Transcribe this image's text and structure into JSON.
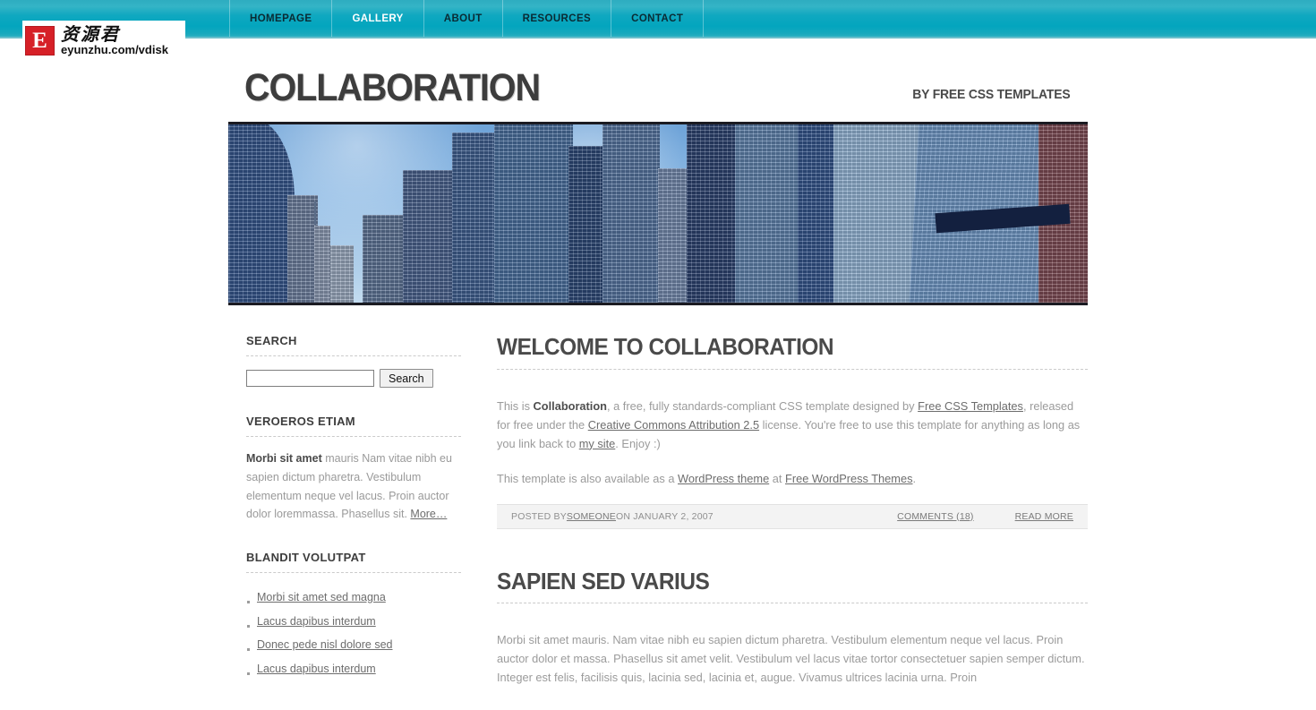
{
  "watermark": {
    "mark_letter": "E",
    "cn_text": "资源君",
    "url_text": "eyunzhu.com/vdisk"
  },
  "nav": {
    "items": [
      {
        "label": "HOMEPAGE",
        "active": false
      },
      {
        "label": "GALLERY",
        "active": true
      },
      {
        "label": "ABOUT",
        "active": false
      },
      {
        "label": "RESOURCES",
        "active": false
      },
      {
        "label": "CONTACT",
        "active": false
      }
    ]
  },
  "masthead": {
    "title": "COLLABORATION",
    "tagline": "BY FREE CSS TEMPLATES"
  },
  "banner": {
    "alt": "skyscrapers-photo"
  },
  "sidebar": {
    "search": {
      "heading": "SEARCH",
      "value": "",
      "placeholder": "",
      "button_label": "Search"
    },
    "about": {
      "heading": "VEROEROS ETIAM",
      "lead": "Morbi sit amet",
      "text": " mauris Nam vitae nibh eu sapien dictum pharetra. Vestibulum elementum neque vel lacus. Proin auctor dolor loremmassa. Phasellus sit. ",
      "more_label": "More…"
    },
    "links": {
      "heading": "BLANDIT VOLUTPAT",
      "items": [
        "Morbi sit amet sed magna",
        "Lacus dapibus interdum",
        "Donec pede nisl dolore sed",
        "Lacus dapibus interdum"
      ]
    }
  },
  "posts": [
    {
      "title": "WELCOME TO COLLABORATION",
      "p1_a": "This is ",
      "p1_b": "Collaboration",
      "p1_c": ", a free, fully standards-compliant CSS template designed by ",
      "p1_link1": "Free CSS Templates",
      "p1_d": ", released for free under the ",
      "p1_link2": "Creative Commons Attribution 2.5",
      "p1_e": " license. You're free to use this template for anything as long as you link back to ",
      "p1_link3": "my site",
      "p1_f": ". Enjoy :)",
      "p2_a": "This template is also available as a ",
      "p2_link1": "WordPress theme",
      "p2_b": " at ",
      "p2_link2": "Free WordPress Themes",
      "p2_c": ".",
      "meta": {
        "posted_by_label": "POSTED BY ",
        "author": "SOMEONE",
        "date_label": " ON JANUARY 2, 2007",
        "comments": "COMMENTS (18)",
        "read_more": "READ MORE"
      }
    },
    {
      "title": "SAPIEN SED VARIUS",
      "body": "Morbi sit amet mauris. Nam vitae nibh eu sapien dictum pharetra. Vestibulum elementum neque vel lacus. Proin auctor dolor et massa. Phasellus sit amet velit. Vestibulum vel lacus vitae tortor consectetuer sapien semper dictum. Integer est felis, facilisis quis, lacinia sed, lacinia et, augue. Vivamus ultrices lacinia urna. Proin"
    }
  ],
  "colors": {
    "nav_teal": "#0fa8c0",
    "nav_teal_light": "#34b4c6",
    "logo_red": "#d62027",
    "heading_gray": "#4a4a4a",
    "body_gray": "#9b9b9b",
    "meta_bg": "#f3f3f3"
  }
}
